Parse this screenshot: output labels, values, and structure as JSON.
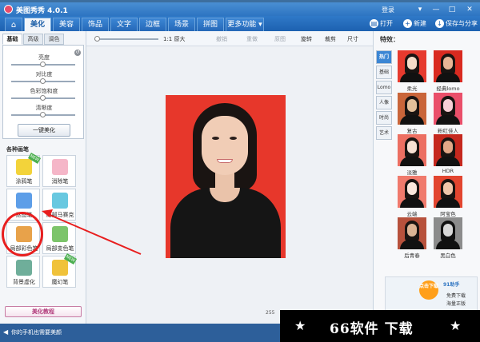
{
  "app": {
    "title": "美图秀秀 4.0.1",
    "login": "登录"
  },
  "window_controls": {
    "minimize": "▾",
    "restore": "—",
    "maximize": "□",
    "close": "✕"
  },
  "menu": {
    "tabs": [
      "美化",
      "美容",
      "饰品",
      "文字",
      "边框",
      "场景",
      "拼图",
      "更多功能 ▾"
    ],
    "active_tab": "美化",
    "open_label": "打开",
    "new_label": "新建",
    "save_label": "保存与分享"
  },
  "left_panel": {
    "subtabs": [
      "基础",
      "高级",
      "调色"
    ],
    "active_subtab": "基础",
    "adjustments": [
      "亮度",
      "对比度",
      "色彩饱和度",
      "清晰度"
    ],
    "adjust_levels": [
      0.5,
      0.5,
      0.5,
      0.5
    ],
    "one_key_label": "一键美化",
    "section_title": "各种画笔",
    "brushes": [
      {
        "label": "涂鸦笔",
        "badge": ""
      },
      {
        "label": "消除笔",
        "badge": ""
      },
      {
        "label": "抠图笔",
        "badge": ""
      },
      {
        "label": "局部马赛克",
        "badge": ""
      },
      {
        "label": "局部彩色笔",
        "badge": ""
      },
      {
        "label": "局部变色笔",
        "badge": ""
      },
      {
        "label": "背景虚化",
        "badge": ""
      },
      {
        "label": "魔幻笔",
        "badge": ""
      }
    ],
    "tutorial_label": "美化教程"
  },
  "toolbar": {
    "original_size": "1:1 原大",
    "undo": "撤销",
    "redo": "重做",
    "original": "原图",
    "rotate": "旋转",
    "crop": "裁剪",
    "resize": "尺寸"
  },
  "canvas": {
    "size_text": "255"
  },
  "right_panel": {
    "title": "特效：",
    "categories": [
      "热门",
      "基础",
      "Lomo",
      "人像",
      "时尚",
      "艺术"
    ],
    "active_category": "热门",
    "effects": [
      "柔光",
      "经典lomo",
      "复古",
      "粉红佳人",
      "淡雅",
      "HDR",
      "云端",
      "阿宝色",
      "后青春",
      "黑白色"
    ]
  },
  "ad": {
    "button": "点击下载",
    "brand": "91助手",
    "line1": "免费下载",
    "line2": "海量正版"
  },
  "statusbar": {
    "text": "你的手机也需要美颜"
  },
  "watermark": {
    "star": "★",
    "text": "66软件 下载"
  },
  "colors": {
    "accent": "#2d74c2",
    "photo_bg": "#e7372b",
    "callout": "#e81e1e"
  }
}
